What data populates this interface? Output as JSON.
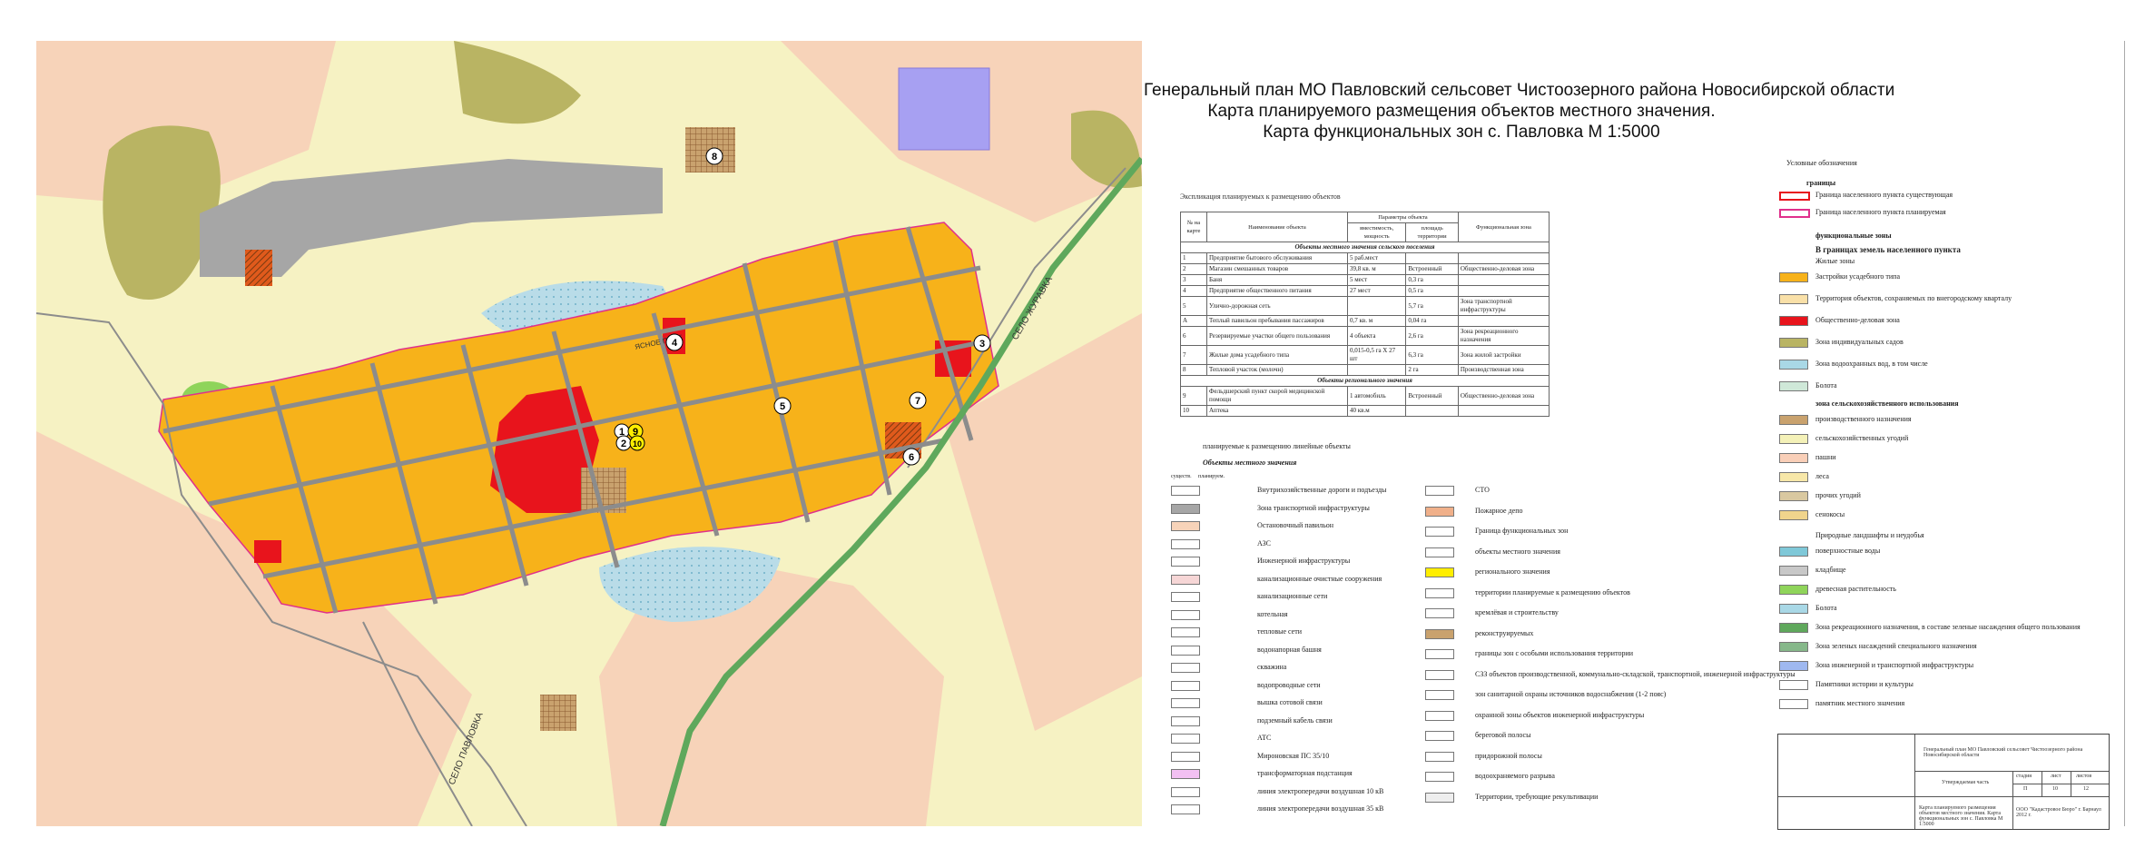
{
  "title": {
    "line1": "Генеральный план МО Павловский сельсовет Чистоозерного района Новосибирской области",
    "line2": "Карта планируемого размещения объектов местного значения.",
    "line3": "Карта функциональных зон с. Павловка М 1:5000"
  },
  "map": {
    "road_label_1": "СЕЛО ЖУРАВКА",
    "road_label_2": "СЕЛО ПАВЛОВКА",
    "road_label_3": "ЯСНОЕ ПОЛЕ",
    "markers": [
      "1",
      "2",
      "3",
      "4",
      "5",
      "6",
      "7",
      "8",
      "9",
      "10"
    ],
    "colors": {
      "residential": "#f7b21a",
      "public": "#e8141c",
      "industrial": "#a0a0a0",
      "agri": "#f4f1b8",
      "forest": "#b9b463",
      "water": "#a9d8e6",
      "field": "#f9cfb8",
      "road": "#8c8c8c"
    }
  },
  "explication": {
    "caption": "Экспликация планируемых к размещению объектов",
    "headers": {
      "num": "№ на карте",
      "name": "Наименование объекта",
      "params": "Параметры объекта",
      "capacity": "вместимость, мощность",
      "area": "площадь территории",
      "zone": "Функциональная зона"
    },
    "section1": "Объекты местного значения сельского поселения",
    "rows": [
      {
        "n": "1",
        "name": "Предприятие бытового обслуживания",
        "cap": "5 раб.мест",
        "area": "",
        "zone": ""
      },
      {
        "n": "2",
        "name": "Магазин смешанных товаров",
        "cap": "39,8 кв. м",
        "area": "Встроенный",
        "zone": "Общественно-деловая зона"
      },
      {
        "n": "3",
        "name": "Баня",
        "cap": "5 мест",
        "area": "0,3 га",
        "zone": ""
      },
      {
        "n": "4",
        "name": "Предприятие общественного питания",
        "cap": "27 мест",
        "area": "0,5 га",
        "zone": ""
      },
      {
        "n": "5",
        "name": "Улично-дорожная сеть",
        "cap": "",
        "area": "5,7 га",
        "zone": "Зона транспортной инфраструктуры"
      },
      {
        "n": "А",
        "name": "Теплый павильон пребывания пассажиров",
        "cap": "0,7 кв. м",
        "area": "0,04 га",
        "zone": ""
      },
      {
        "n": "6",
        "name": "Резервируемые участки общего пользования",
        "cap": "4 объекта",
        "area": "2,6 га",
        "zone": "Зона рекреационного назначения"
      },
      {
        "n": "7",
        "name": "Жилые дома усадебного типа",
        "cap": "0,015-0,5 га X 27 шт",
        "area": "6,3 га",
        "zone": "Зона жилой застройки"
      },
      {
        "n": "8",
        "name": "Тепловой участок (молочн)",
        "cap": "",
        "area": "2 га",
        "zone": "Производственная зона"
      }
    ],
    "section2": "Объекты регионального значения",
    "rows2": [
      {
        "n": "9",
        "name": "Фельдшерский пункт скорой медицинской помощи",
        "cap": "1 автомобиль",
        "area": "Встроенный",
        "zone": "Общественно-деловая зона"
      },
      {
        "n": "10",
        "name": "Аптека",
        "cap": "40 кв.м",
        "area": "",
        "zone": ""
      }
    ]
  },
  "legend_left": {
    "note": "планируемые к размещению линейные объекты",
    "head": "Объекты местного значения",
    "col1": "существ.",
    "col2": "планируем.",
    "items": [
      "Внутрихозяйственные дороги и подъезды",
      "Зона транспортной инфраструктуры",
      "Остановочный павильон",
      "АЗС",
      "Инженерной инфраструктуры",
      "канализационные очистные сооружения",
      "канализационные сети",
      "котельная",
      "тепловые сети",
      "водонапорная башня",
      "скважина",
      "водопроводные сети",
      "вышка сотовой связи",
      "подземный кабель связи",
      "АТС",
      "Мироновская ПС 35/10",
      "трансформаторная подстанция",
      "линия электропередачи воздушная 10 кВ",
      "линия электропередачи воздушная 35 кВ"
    ]
  },
  "legend_mid": {
    "items": [
      "СТО",
      "Пожарное депо",
      "Граница функциональных зон",
      "объекты местного значения",
      "регионального значения",
      "территории планируемые к размещению объектов",
      "кремлёвая и строительству",
      "реконструируемых",
      "границы зон с особыми использования территории",
      "СЗЗ объектов производственной, коммунально-складской, транспортной, инженерной инфраструктуры",
      "зон санитарной охраны источников водоснабжения (1-2 пояс)",
      "охранной зоны объектов инженерной инфраструктуры",
      "береговой полосы",
      "придорожной полосы",
      "водоохраняемого разрыва",
      "Территории, требующие рекультивации"
    ]
  },
  "legend_right": {
    "head": "Условные обозначения",
    "borders_head": "границы",
    "borders": [
      "Граница населенного пункта существующая",
      "Граница населенного пункта планируемая"
    ],
    "func_head": "функциональные зоны",
    "func_sub": "В границах земель населенного пункта",
    "zone_head": "Жилые зоны",
    "items": [
      "Застройки усадебного типа",
      "Территория объектов, сохраняемых по внегородскому кварталу",
      "Общественно-деловая зона",
      "Зона индивидуальных садов",
      "Зона водоохранных вод, в том числе",
      "Болота"
    ],
    "agri_head": "зона сельскохозяйственного использования",
    "agri_items": [
      "производственного назначения",
      "сельскохозяйственных угодий",
      "пашни",
      "леса",
      "прочих угодий",
      "сенокосы"
    ],
    "other_head": "Природные ландшафты и неудобья",
    "other_items": [
      "поверхностные воды",
      "кладбище",
      "древесная растительность",
      "Болота",
      "Зона рекреационного назначения, в составе зеленые насаждения общего пользования",
      "Зона зеленых насаждений специального назначения",
      "Зона инженерной и транспортной инфраструктуры",
      "Памятники истории и культуры",
      "памятник местного значения"
    ]
  },
  "stamp": {
    "title": "Генеральный план МО Павловский сельсовет Чистоозерного района Новосибирской области",
    "stage": "Утверждаемая часть",
    "sheet_head": "стадия",
    "sheet_label": "лист",
    "sheets_label": "листов",
    "stage_val": "П",
    "sheet_val": "10",
    "sheets_val": "12",
    "desc": "Карта планируемого размещения объектов местного значения. Карта функциональных зон с. Павловка М 1:5000",
    "org": "ООО \"Кадастровое Бюро\" г. Барнаул 2012 г."
  }
}
